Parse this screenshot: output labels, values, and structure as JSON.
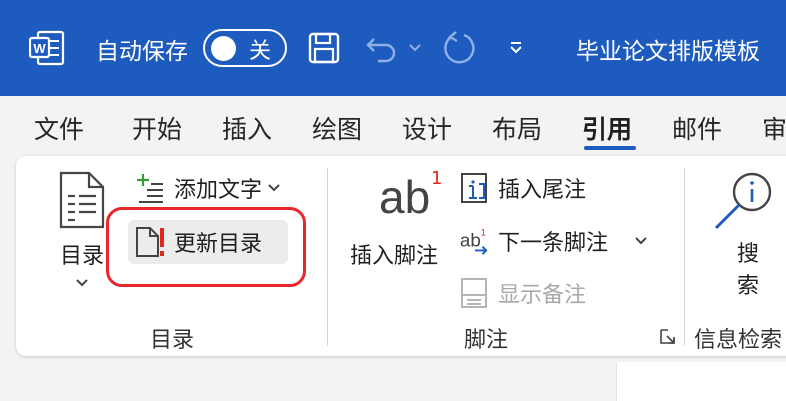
{
  "titlebar": {
    "autosave_label": "自动保存",
    "autosave_state": "关",
    "document_title": "毕业论文排版模板"
  },
  "tabs": [
    "文件",
    "开始",
    "插入",
    "绘图",
    "设计",
    "布局",
    "引用",
    "邮件",
    "审"
  ],
  "active_tab": "引用",
  "ribbon": {
    "toc_group": {
      "toc_button": "目录",
      "add_text": "添加文字",
      "update_toc": "更新目录",
      "label": "目录"
    },
    "footnotes_group": {
      "insert_footnote": "插入脚注",
      "insert_footnote_glyph": "ab",
      "insert_footnote_sup": "1",
      "insert_endnote": "插入尾注",
      "next_footnote": "下一条脚注",
      "show_notes": "显示备注",
      "label": "脚注"
    },
    "research_group": {
      "search_line1": "搜",
      "search_line2": "索",
      "label": "信息检索"
    }
  },
  "colors": {
    "titlebar_bg": "#1e5bbf",
    "highlight_ring": "#e8262c",
    "accent": "#1e5bbf"
  }
}
